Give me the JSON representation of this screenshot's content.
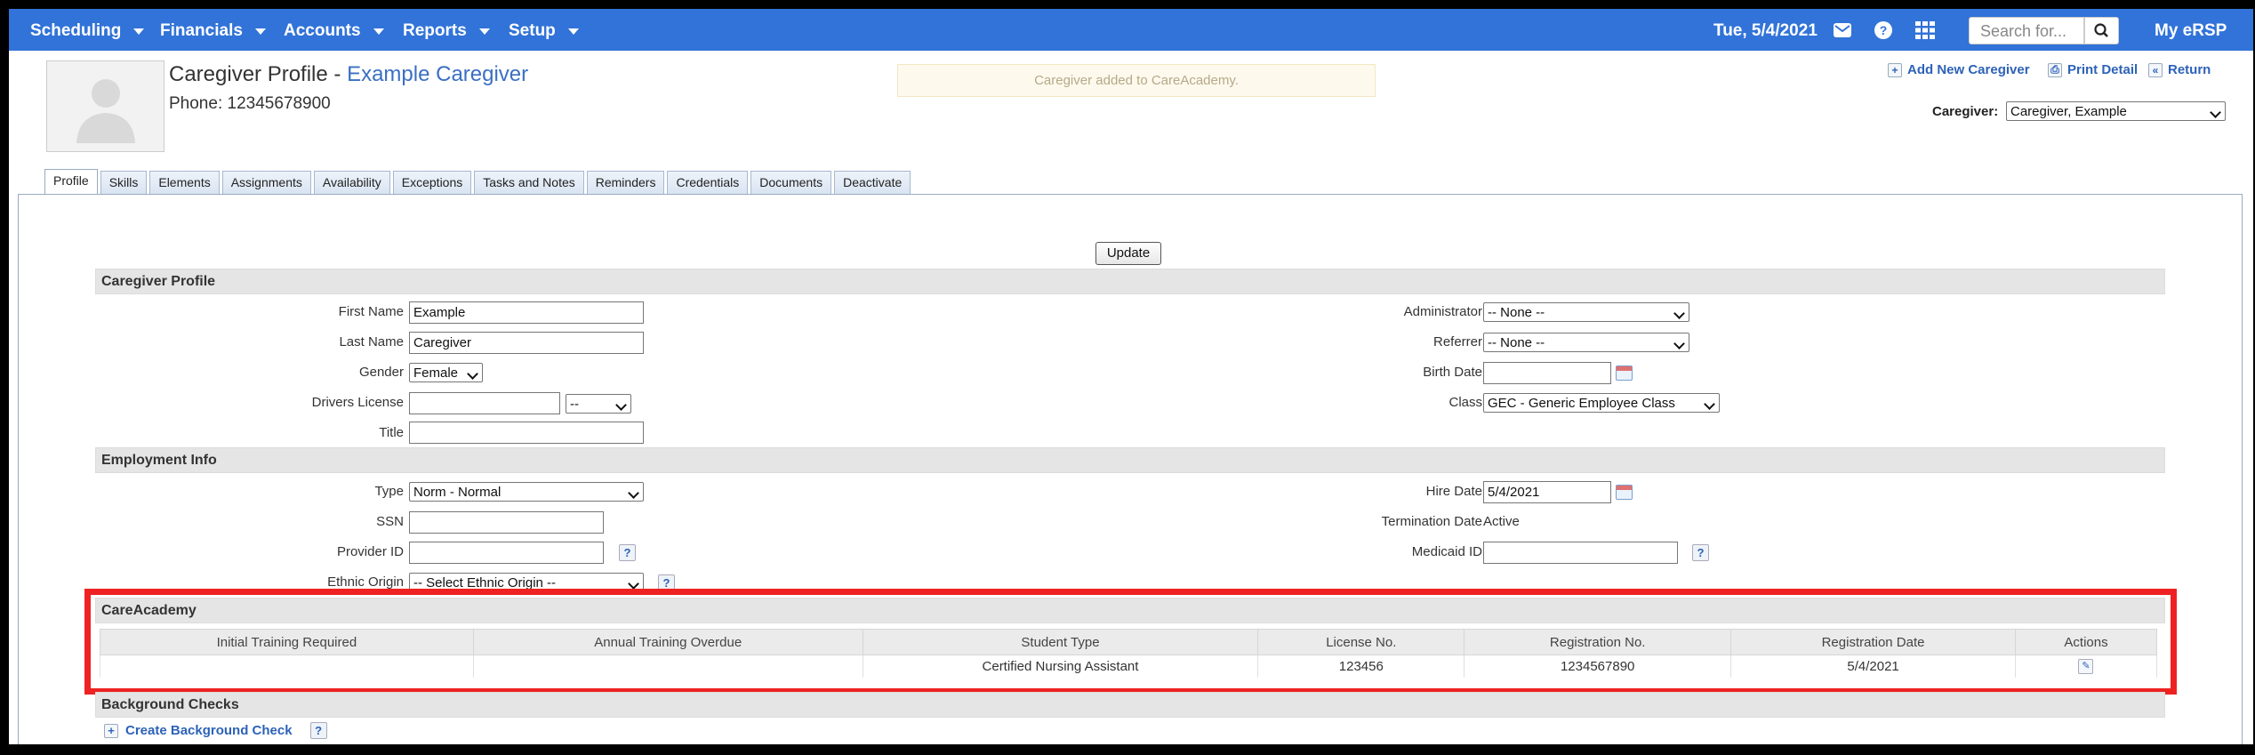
{
  "nav": {
    "items": [
      "Scheduling",
      "Financials",
      "Accounts",
      "Reports",
      "Setup"
    ],
    "date": "Tue, 5/4/2021",
    "search_placeholder": "Search for...",
    "account": "My eRSP",
    "icons": [
      "mail-icon",
      "help-icon",
      "apps-grid-icon",
      "search-icon"
    ]
  },
  "header": {
    "title_prefix": "Caregiver Profile - ",
    "title_name": "Example Caregiver",
    "phone": "Phone: 12345678900",
    "flash": "Caregiver added to CareAcademy.",
    "links": {
      "add": "Add New Caregiver",
      "print": "Print Detail",
      "return": "Return"
    },
    "caregiver_label": "Caregiver:",
    "caregiver_value": "Caregiver, Example"
  },
  "tabs": [
    "Profile",
    "Skills",
    "Elements",
    "Assignments",
    "Availability",
    "Exceptions",
    "Tasks and Notes",
    "Reminders",
    "Credentials",
    "Documents",
    "Deactivate"
  ],
  "update_label": "Update",
  "profile": {
    "section": "Caregiver Profile",
    "first_name_label": "First Name",
    "first_name": "Example",
    "last_name_label": "Last Name",
    "last_name": "Caregiver",
    "gender_label": "Gender",
    "gender": "Female",
    "drivers_license_label": "Drivers License",
    "drivers_license_state": "--",
    "title_label": "Title",
    "title": "",
    "administrator_label": "Administrator",
    "administrator": "-- None --",
    "referrer_label": "Referrer",
    "referrer": "-- None --",
    "birth_date_label": "Birth Date",
    "birth_date": "",
    "class_label": "Class",
    "class": "GEC - Generic Employee Class"
  },
  "employment": {
    "section": "Employment Info",
    "type_label": "Type",
    "type": "Norm - Normal",
    "ssn_label": "SSN",
    "provider_id_label": "Provider ID",
    "ethnic_origin_label": "Ethnic Origin",
    "ethnic_origin": "-- Select Ethnic Origin --",
    "hire_date_label": "Hire Date",
    "hire_date": "5/4/2021",
    "termination_label": "Termination Date",
    "termination": "Active",
    "medicaid_label": "Medicaid ID"
  },
  "careacademy": {
    "section": "CareAcademy",
    "columns": [
      "Initial Training Required",
      "Annual Training Overdue",
      "Student Type",
      "License No.",
      "Registration No.",
      "Registration Date",
      "Actions"
    ],
    "row": [
      "",
      "",
      "Certified Nursing Assistant",
      "123456",
      "1234567890",
      "5/4/2021"
    ]
  },
  "background": {
    "section": "Background Checks",
    "create_label": "Create Background Check"
  },
  "colors": {
    "nav": "#3173d8",
    "link": "#2d62b8",
    "highlight": "#ee2222"
  }
}
